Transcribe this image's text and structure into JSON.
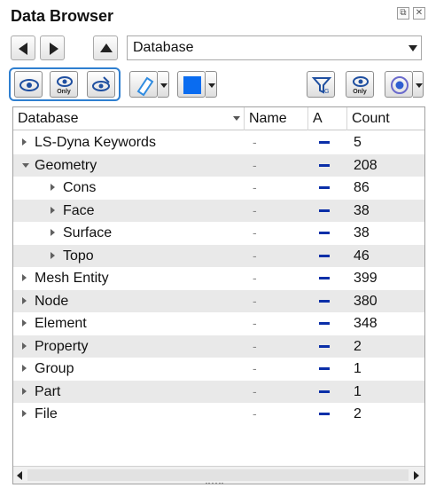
{
  "panel": {
    "title": "Data Browser",
    "float_glyph": "⧉",
    "close_glyph": "✕"
  },
  "nav": {
    "combo_value": "Database"
  },
  "toolbar": {
    "show_only_label": "Only",
    "filter_only_label": "Only",
    "color_swatch": "#0a6cf0"
  },
  "columns": [
    "Database",
    "Name",
    "A",
    "Count"
  ],
  "rows": [
    {
      "label": "LS-Dyna Keywords",
      "name": "-",
      "count": "5",
      "level": 0,
      "expanded": false
    },
    {
      "label": "Geometry",
      "name": "-",
      "count": "208",
      "level": 0,
      "expanded": true
    },
    {
      "label": "Cons",
      "name": "-",
      "count": "86",
      "level": 1,
      "expanded": false
    },
    {
      "label": "Face",
      "name": "-",
      "count": "38",
      "level": 1,
      "expanded": false
    },
    {
      "label": "Surface",
      "name": "-",
      "count": "38",
      "level": 1,
      "expanded": false
    },
    {
      "label": "Topo",
      "name": "-",
      "count": "46",
      "level": 1,
      "expanded": false
    },
    {
      "label": "Mesh Entity",
      "name": "-",
      "count": "399",
      "level": 0,
      "expanded": false
    },
    {
      "label": "Node",
      "name": "-",
      "count": "380",
      "level": 0,
      "expanded": false
    },
    {
      "label": "Element",
      "name": "-",
      "count": "348",
      "level": 0,
      "expanded": false
    },
    {
      "label": "Property",
      "name": "-",
      "count": "2",
      "level": 0,
      "expanded": false
    },
    {
      "label": "Group",
      "name": "-",
      "count": "1",
      "level": 0,
      "expanded": false
    },
    {
      "label": "Part",
      "name": "-",
      "count": "1",
      "level": 0,
      "expanded": false
    },
    {
      "label": "File",
      "name": "-",
      "count": "2",
      "level": 0,
      "expanded": false
    }
  ]
}
